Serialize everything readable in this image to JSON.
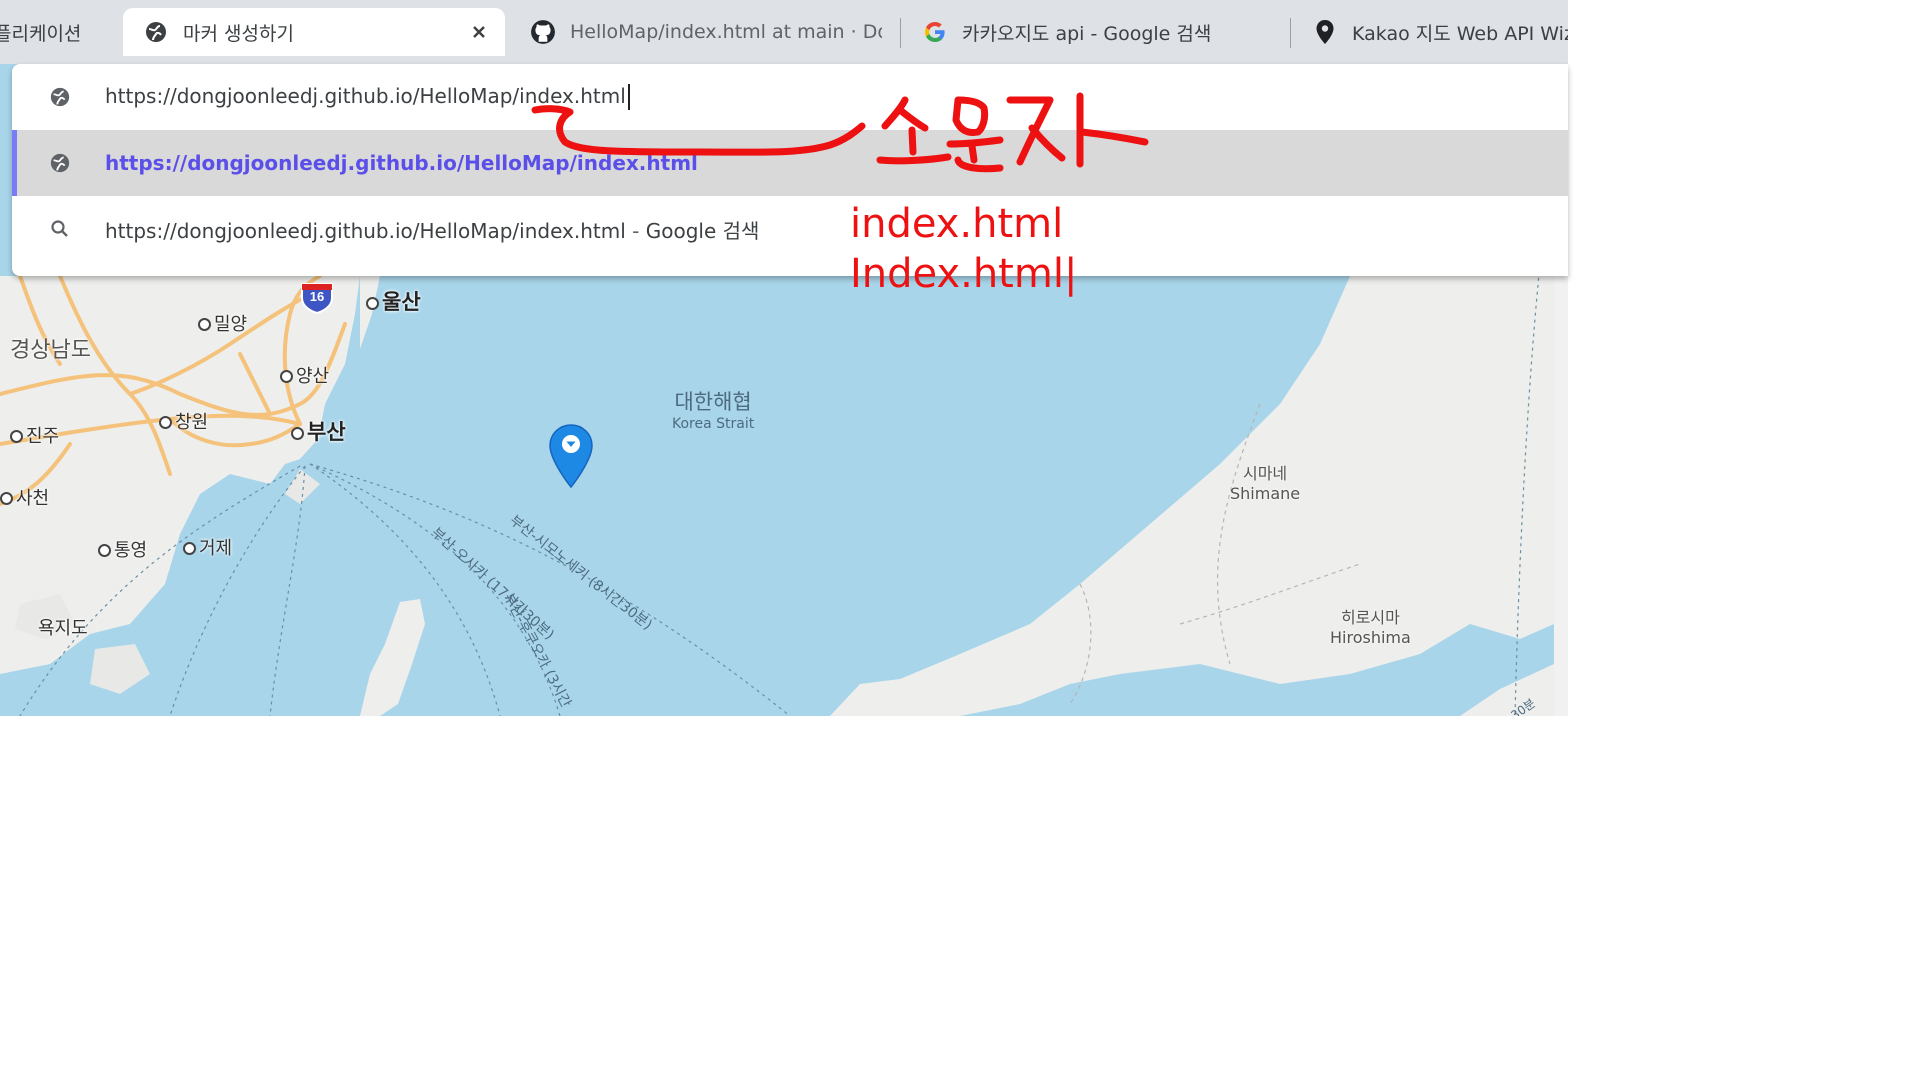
{
  "tabs": [
    {
      "title": "플리케이션",
      "icon": "none",
      "active": false
    },
    {
      "title": "마커 생성하기",
      "icon": "globe-icon",
      "active": true
    },
    {
      "title": "HelloMap/index.html at main · Dor",
      "icon": "github-icon",
      "active": false
    },
    {
      "title": "카카오지도 api - Google 검색",
      "icon": "google-icon",
      "active": false
    },
    {
      "title": "Kakao 지도 Web API Wiz",
      "icon": "map-pin-icon",
      "active": false
    }
  ],
  "omnibox": {
    "input_value": "https://dongjoonleedj.github.io/HelloMap/index.html",
    "suggestion_url": "https://dongjoonleedj.github.io/HelloMap/index.html",
    "search_query": "https://dongjoonleedj.github.io/HelloMap/index.html",
    "search_separator": " - ",
    "search_engine": "Google 검색"
  },
  "annotation": {
    "handwritten": "소문자",
    "line1": "index.html",
    "line2": "Index.html|",
    "color": "#ee1111"
  },
  "map": {
    "sea_ko": "대한해협",
    "sea_en": "Korea Strait",
    "province": "경상남도",
    "highway": "16",
    "cities": [
      {
        "name": "울산"
      },
      {
        "name": "밀양"
      },
      {
        "name": "양산"
      },
      {
        "name": "창원"
      },
      {
        "name": "부산"
      },
      {
        "name": "진주"
      },
      {
        "name": "사천"
      },
      {
        "name": "통영"
      },
      {
        "name": "거제"
      },
      {
        "name": "욕지도"
      }
    ],
    "regions": [
      {
        "ko": "시마네",
        "en": "Shimane"
      },
      {
        "ko": "히로시마",
        "en": "Hiroshima"
      }
    ],
    "routes": [
      "부산-시모노세키 (8시간30분)",
      "부산-오사카 (17시간30분)",
      "부산-후쿠오카 (3시간"
    ],
    "edge_text": "30분",
    "sea_color": "#a8d5ea",
    "land_color": "#eeeeec"
  }
}
